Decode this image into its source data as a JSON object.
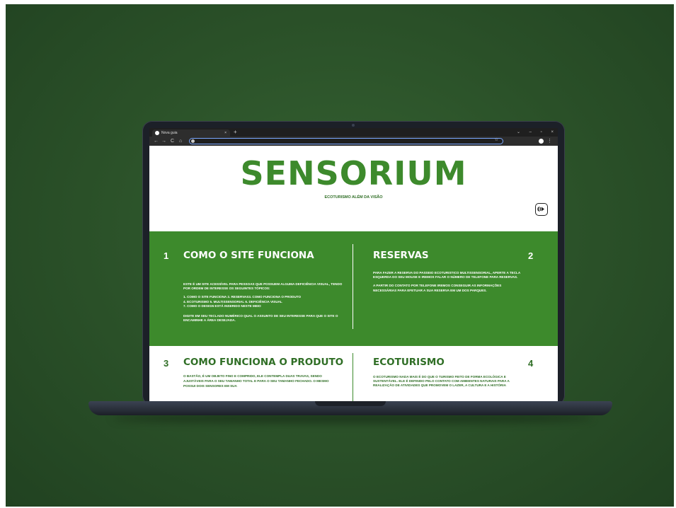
{
  "browser": {
    "tab_title": "Nova guia",
    "tab_close": "×",
    "new_tab": "+",
    "window_controls": [
      "⌄",
      "–",
      "▫",
      "×"
    ],
    "nav": {
      "back": "←",
      "forward": "→",
      "reload": "C",
      "home": "⌂"
    },
    "bookmark_icon": "☆",
    "menu": "⋮"
  },
  "page": {
    "brand": "SENSORIUM",
    "tagline": "ECOTURISMO ALÉM DA VISÃO",
    "audio_icon": "audio-play-icon",
    "sections": [
      {
        "number": "1",
        "title": "COMO O SITE FUNCIONA",
        "paragraphs": [
          "ESTE É UM SITE ACESSÍVEL PARA PESSOAS QUE POSSUEM ALGUMA DEFICIÊNCIA VISUAL, TENDO POR ORDEM DE INTERESSE OS SEGUINTES TÓPICOS:",
          "1. COMO O SITE FUNCIONA          2. RESERVAS3. COMO FUNCIONA O PRODUTO",
          "4. ECOTURISMO          5. MULTISSENSORIAL          6. DEFICIÊNCIA VISUAL",
          "7. COMO O DESIGN ESTÁ INSERIDO NESTE MEIO",
          "DIGITE EM SEU TECLADO NUMÉRICO QUAL O ASSUNTO DE SEU INTERESSE PARA QUE O SITE O ENCAMINHE A ÁREA DESEJADA."
        ]
      },
      {
        "number": "2",
        "title": "RESERVAS",
        "paragraphs": [
          "PARA FAZER A RESERVA DO PASSEIO ECOTURISTICO MULTISSENSORIAL, APERTE A TECLA ESQUERDA DO SEU MOUSE E IREMOS FALAR O NÚMERO DE TELEFONE PARA RESERVAS.",
          "A PARTIR DO CONTATO POR TELEFONE IREMOS CONSEGUIR AS INFORMAÇÕES NECESSÁRIAS PARA EFETUAR A SUA RESERVA EM UM DOS PARQUES."
        ]
      },
      {
        "number": "3",
        "title": "COMO FUNCIONA O PRODUTO",
        "paragraphs": [
          "O BASTÃO, É UM OBJETO FINO E COMPRIDO, ELE CONTEMPLA DUAS TRAVAS, SENDO AJUSTÁVEIS PARA O SEU TAMANHO TOTAL E PARA O SEU TAMANHO FECHADO. O MESMO POSSUI DOIS SENSORES EM SUA"
        ]
      },
      {
        "number": "4",
        "title": "ECOTURISMO",
        "paragraphs": [
          "O ECOTURISMO NADA MAIS É DO QUE O TURISMO FEITO DE FORMA ECOLÓGICA E SUSTENTÁVEL. ELE É DEFINIDO PELO CONTATO COM AMBIENTES NATURAIS PARA A REALIZAÇÃO DE ATIVIDADES QUE PROMOVEM O LAZER, A CULTURA E A HISTÓRIA"
        ]
      }
    ]
  },
  "colors": {
    "background": "#2a5028",
    "accent_green": "#3d8a2c",
    "dark_green_text": "#2f6e25",
    "laptop": "#1c2028"
  }
}
